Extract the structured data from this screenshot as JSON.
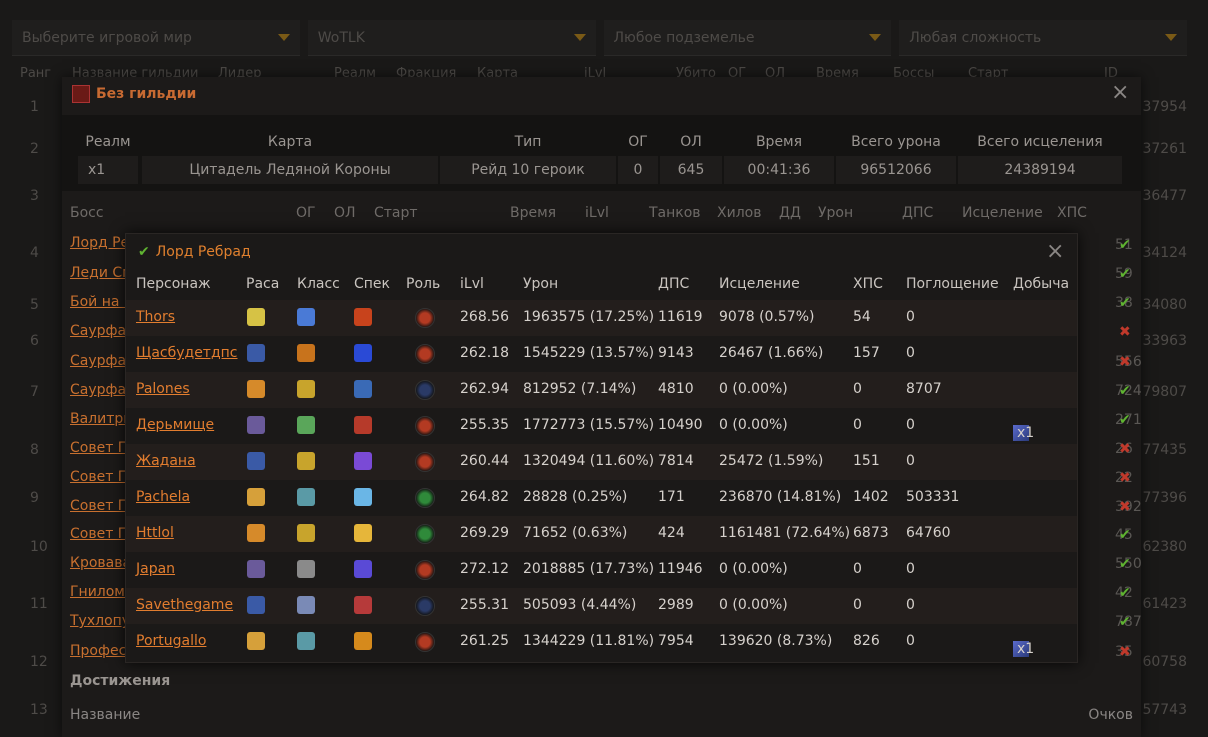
{
  "filters": {
    "world": "Выберите игровой мир",
    "expansion": "WoTLK",
    "dungeon": "Любое подземелье",
    "difficulty": "Любая сложность"
  },
  "bg_table": {
    "headers": [
      "Ранг",
      "Название гильдии",
      "Лидер",
      "Реалм",
      "Фракция",
      "Карта",
      "iLvl",
      "Убито",
      "ОГ",
      "ОЛ",
      "Время",
      "Боссы",
      "Старт",
      "ID"
    ],
    "rows": [
      {
        "rank": "1",
        "id": "37954"
      },
      {
        "rank": "2",
        "id": "37261"
      },
      {
        "rank": "3",
        "id": "36477"
      },
      {
        "rank": "4",
        "id": "34124"
      },
      {
        "rank": "5",
        "id": "34080"
      },
      {
        "rank": "6",
        "id": "33963"
      },
      {
        "rank": "7",
        "id": "79807"
      },
      {
        "rank": "8",
        "id": "77435"
      },
      {
        "rank": "9",
        "id": "77396"
      },
      {
        "rank": "10",
        "id": "62380"
      },
      {
        "rank": "11",
        "id": "61423"
      },
      {
        "rank": "12",
        "id": "60758"
      },
      {
        "rank": "13",
        "id": "57743"
      }
    ]
  },
  "raid_modal": {
    "title": "Без гильдии",
    "summary_headers": {
      "realm": "Реалм",
      "map": "Карта",
      "type": "Тип",
      "og": "ОГ",
      "ol": "ОЛ",
      "time": "Время",
      "total_damage": "Всего урона",
      "total_healing": "Всего исцеления"
    },
    "summary_values": {
      "realm": "x1",
      "map": "Цитадель Ледяной Короны",
      "type": "Рейд 10 героик",
      "og": "0",
      "ol": "645",
      "time": "00:41:36",
      "total_damage": "96512066",
      "total_healing": "24389194"
    },
    "boss_headers": {
      "boss": "Босс",
      "og": "ОГ",
      "ol": "ОЛ",
      "start": "Старт",
      "time": "Время",
      "ilvl": "iLvl",
      "tanks": "Танков",
      "healers": "Хилов",
      "dd": "ДД",
      "damage": "Урон",
      "dps": "ДПС",
      "healing": "Исцеление",
      "hps": "ХПС"
    },
    "bosses": [
      {
        "name": "Лорд Ре",
        "tail": "51",
        "status": "ok"
      },
      {
        "name": "Леди См",
        "tail": "59",
        "status": "ok"
      },
      {
        "name": "Бой на К",
        "tail": "38",
        "status": "ok"
      },
      {
        "name": "Саурфан",
        "tail": "",
        "status": "fail"
      },
      {
        "name": "Саурфан",
        "tail": "556",
        "status": "fail"
      },
      {
        "name": "Саурфан",
        "tail": "724",
        "status": "ok"
      },
      {
        "name": "Валитри",
        "tail": "271",
        "status": "ok"
      },
      {
        "name": "Совет П",
        "tail": "26",
        "status": "fail"
      },
      {
        "name": "Совет П",
        "tail": "22",
        "status": "fail"
      },
      {
        "name": "Совет П",
        "tail": "392",
        "status": "fail"
      },
      {
        "name": "Совет П",
        "tail": "45",
        "status": "ok"
      },
      {
        "name": "Кровава",
        "tail": "550",
        "status": "ok"
      },
      {
        "name": "Гниломе",
        "tail": "42",
        "status": "ok"
      },
      {
        "name": "Тухлопу",
        "tail": "787",
        "status": "ok"
      },
      {
        "name": "Профес",
        "tail": "35",
        "status": "fail"
      }
    ],
    "achievements_title": "Достижения",
    "achievements_name": "Название",
    "achievements_points": "Очков"
  },
  "boss_modal": {
    "title": "Лорд Ребрад",
    "headers": {
      "char": "Персонаж",
      "race": "Раса",
      "class": "Класс",
      "spec": "Спек",
      "role": "Роль",
      "ilvl": "iLvl",
      "damage": "Урон",
      "dps": "ДПС",
      "healing": "Исцеление",
      "hps": "ХПС",
      "absorb": "Поглощение",
      "loot": "Добыча"
    },
    "players": [
      {
        "name": "Thors",
        "ilvl": "268.56",
        "damage": "1963575 (17.25%)",
        "dps": "11619",
        "healing": "9078 (0.57%)",
        "hps": "54",
        "absorb": "0",
        "loot": "",
        "role": "dps",
        "race_color": "#d6c245",
        "class_color": "#4a7ad6",
        "spec_color": "#c8431c"
      },
      {
        "name": "Щасбудетдпс",
        "ilvl": "262.18",
        "damage": "1545229 (13.57%)",
        "dps": "9143",
        "healing": "26467 (1.66%)",
        "hps": "157",
        "absorb": "0",
        "loot": "",
        "role": "dps",
        "race_color": "#3a5aa6",
        "class_color": "#c8731c",
        "spec_color": "#2a4ad6"
      },
      {
        "name": "Palones",
        "ilvl": "262.94",
        "damage": "812952 (7.14%)",
        "dps": "4810",
        "healing": "0 (0.00%)",
        "hps": "0",
        "absorb": "8707",
        "loot": "",
        "role": "tank",
        "race_color": "#d68a2a",
        "class_color": "#c8a42c",
        "spec_color": "#3a6ab6"
      },
      {
        "name": "Дерьмище",
        "ilvl": "255.35",
        "damage": "1772773 (15.57%)",
        "dps": "10490",
        "healing": "0 (0.00%)",
        "hps": "0",
        "absorb": "0",
        "loot": "x1",
        "role": "dps",
        "race_color": "#6a5a9a",
        "class_color": "#5aa65a",
        "spec_color": "#b63a2a"
      },
      {
        "name": "Жадана",
        "ilvl": "260.44",
        "damage": "1320494 (11.60%)",
        "dps": "7814",
        "healing": "25472 (1.59%)",
        "hps": "151",
        "absorb": "0",
        "loot": "",
        "role": "dps",
        "race_color": "#3a5aa6",
        "class_color": "#c8a42c",
        "spec_color": "#7a4ad6"
      },
      {
        "name": "Pachela",
        "ilvl": "264.82",
        "damage": "28828 (0.25%)",
        "dps": "171",
        "healing": "236870 (14.81%)",
        "hps": "1402",
        "absorb": "503331",
        "loot": "",
        "role": "heal",
        "race_color": "#d6a03a",
        "class_color": "#5a9aa6",
        "spec_color": "#6ab6e6"
      },
      {
        "name": "Httlol",
        "ilvl": "269.29",
        "damage": "71652 (0.63%)",
        "dps": "424",
        "healing": "1161481 (72.64%)",
        "hps": "6873",
        "absorb": "64760",
        "loot": "",
        "role": "heal",
        "race_color": "#d68a2a",
        "class_color": "#c8a42c",
        "spec_color": "#e6b63a"
      },
      {
        "name": "Japan",
        "ilvl": "272.12",
        "damage": "2018885 (17.73%)",
        "dps": "11946",
        "healing": "0 (0.00%)",
        "hps": "0",
        "absorb": "0",
        "loot": "",
        "role": "dps",
        "race_color": "#6a5a9a",
        "class_color": "#8a8a8a",
        "spec_color": "#5a4ad6"
      },
      {
        "name": "Savethegame",
        "ilvl": "255.31",
        "damage": "505093 (4.44%)",
        "dps": "2989",
        "healing": "0 (0.00%)",
        "hps": "0",
        "absorb": "0",
        "loot": "",
        "role": "tank",
        "race_color": "#3a5aa6",
        "class_color": "#7a8ab6",
        "spec_color": "#b63a3a"
      },
      {
        "name": "Portugallo",
        "ilvl": "261.25",
        "damage": "1344229 (11.81%)",
        "dps": "7954",
        "healing": "139620 (8.73%)",
        "hps": "826",
        "absorb": "0",
        "loot": "x1",
        "role": "dps",
        "race_color": "#d6a03a",
        "class_color": "#5a9aa6",
        "spec_color": "#d68a1c"
      }
    ]
  }
}
